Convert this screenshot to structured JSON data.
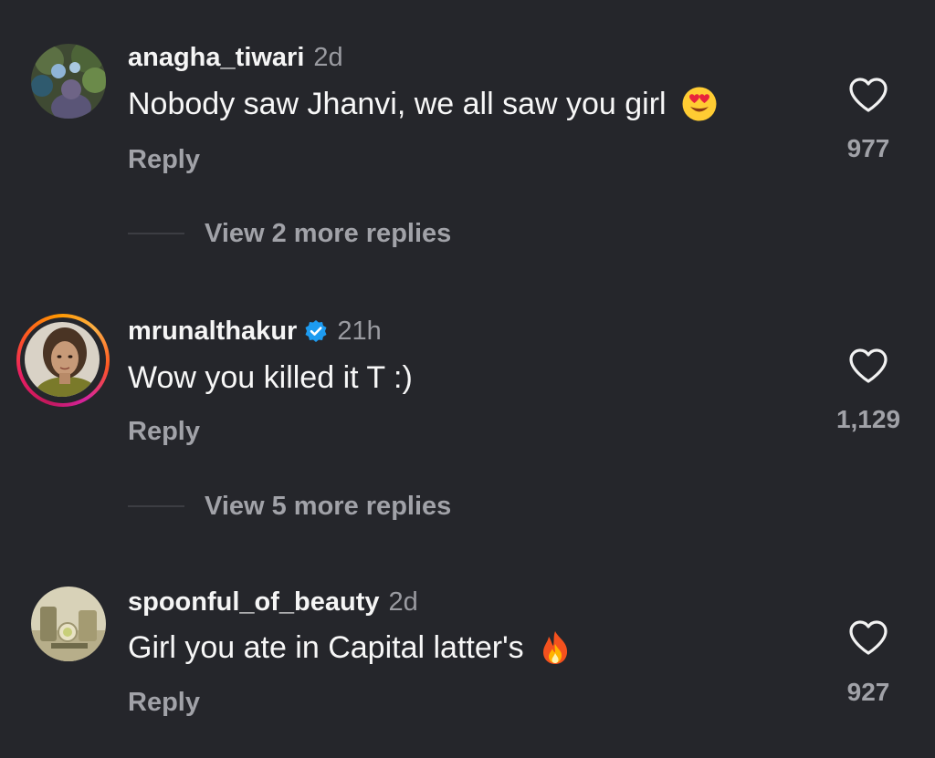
{
  "colors": {
    "background": "#25262b",
    "primary_text": "#f5f5f5",
    "secondary_text": "#a1a2a8",
    "verified_blue": "#1d9bf0"
  },
  "comments": [
    {
      "username": "anagha_tiwari",
      "time": "2d",
      "verified": false,
      "text": "Nobody saw Jhanvi, we all saw you girl",
      "emoji": "smiling-face-with-heart-eyes",
      "reply_label": "Reply",
      "likes": "977",
      "view_replies": "View 2 more replies",
      "avatar_icon": "avatar-photo"
    },
    {
      "username": "mrunalthakur",
      "time": "21h",
      "verified": true,
      "text": "Wow you killed it T :)",
      "reply_label": "Reply",
      "likes": "1,129",
      "view_replies": "View 5 more replies",
      "avatar_icon": "avatar-photo-story-ring"
    },
    {
      "username": "spoonful_of_beauty",
      "time": "2d",
      "verified": false,
      "text": "Girl you ate in Capital latter's",
      "emoji": "fire",
      "reply_label": "Reply",
      "likes": "927",
      "avatar_icon": "avatar-photo"
    }
  ]
}
